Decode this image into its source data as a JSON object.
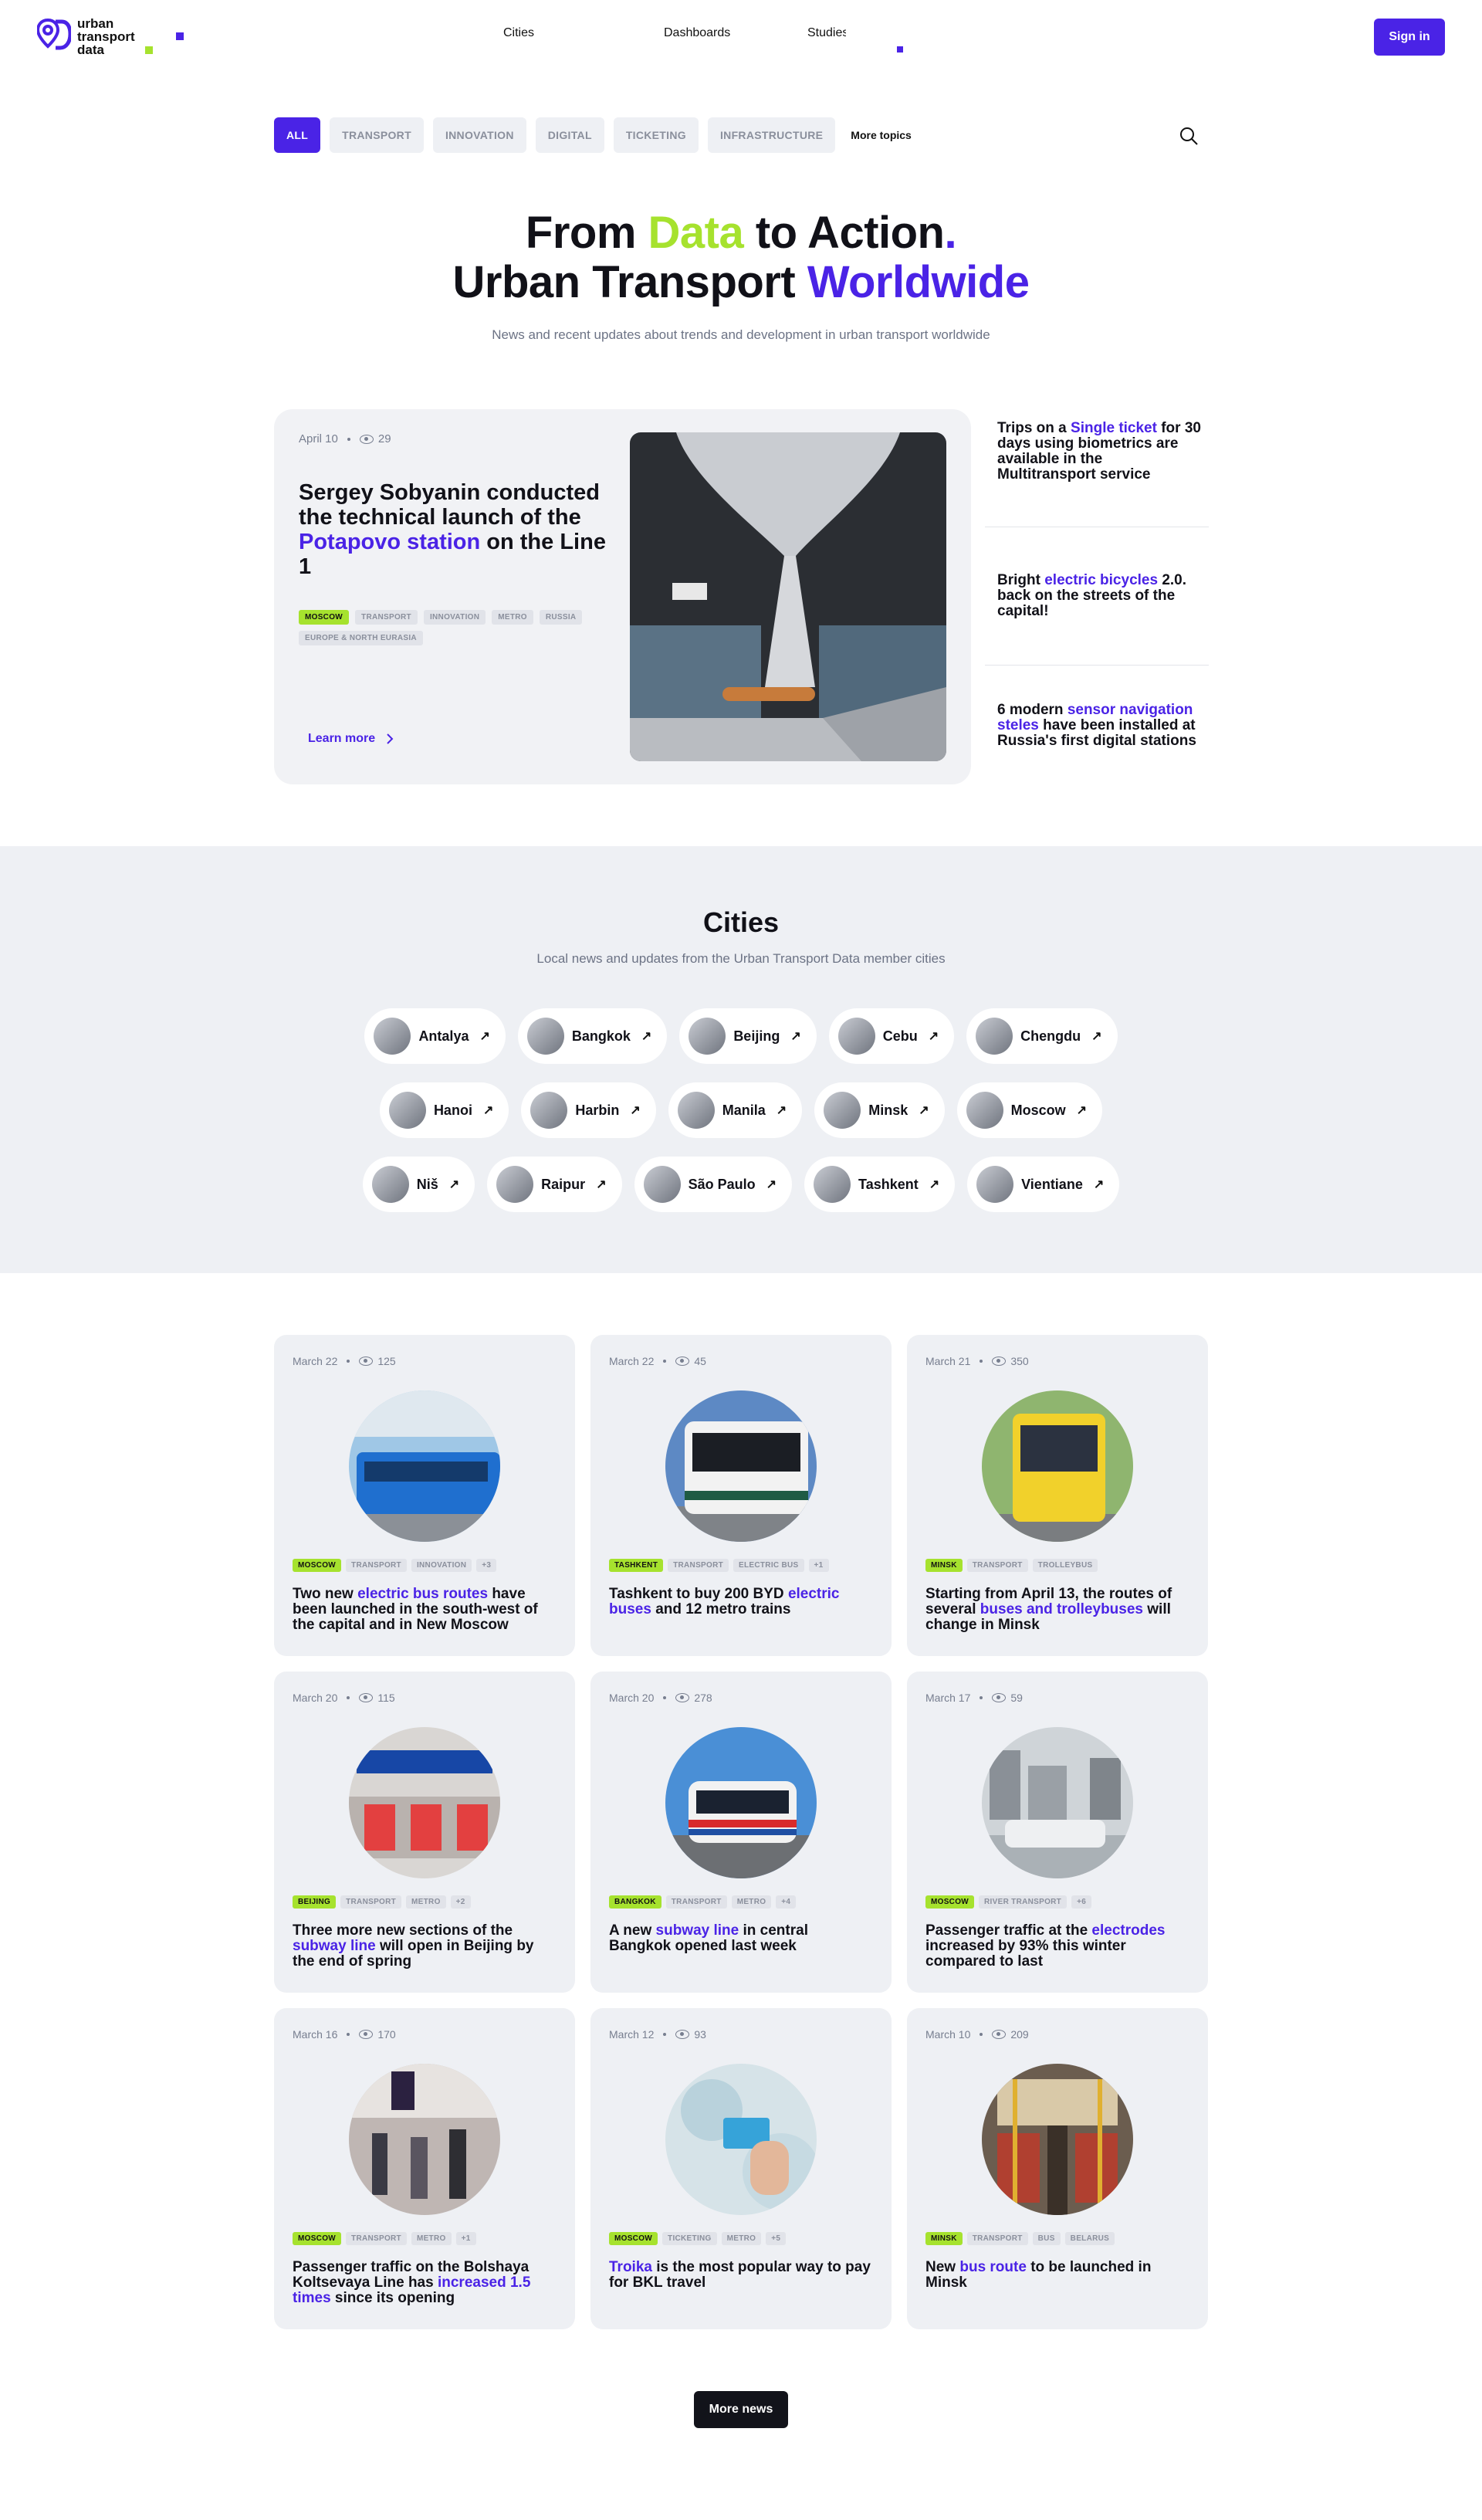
{
  "logo": {
    "line1": "urban",
    "line2": "transport",
    "line3": "data"
  },
  "nav": {
    "items": [
      "Cities",
      "Dashboards",
      "Studies"
    ],
    "signin": "Sign in"
  },
  "topics": {
    "items": [
      "ALL",
      "TRANSPORT",
      "INNOVATION",
      "DIGITAL",
      "TICKETING",
      "INFRASTRUCTURE"
    ],
    "more": "More topics"
  },
  "hero": {
    "l1a": "From ",
    "l1b": "Data",
    "l1c": " to Action",
    "l1d": ".",
    "l2a": "Urban Transport ",
    "l2b": "Worldwide",
    "subtitle": "News and recent updates about trends and development in urban transport worldwide"
  },
  "featured": {
    "date": "April 10",
    "views": "29",
    "t1": "Sergey Sobyanin conducted the technical launch of the ",
    "t2": "Potapovo station",
    "t3": " on the Line 1",
    "tags": [
      "MOSCOW",
      "TRANSPORT",
      "INNOVATION",
      "METRO",
      "RUSSIA",
      "EUROPE & NORTH EURASIA"
    ],
    "learn": "Learn more"
  },
  "side": [
    {
      "a": "Trips on a ",
      "b": "Single ticket",
      "c": " for 30 days using biometrics are available in the Multitransport service"
    },
    {
      "a": "Bright ",
      "b": "electric bicycles",
      "c": " 2.0. back on the streets of the capital!"
    },
    {
      "a": "6 modern ",
      "b": "sensor navigation steles",
      "c": " have been installed at Russia's first digital stations"
    }
  ],
  "cities": {
    "title": "Cities",
    "subtitle": "Local news and updates from the Urban Transport Data member cities",
    "row1": [
      "Antalya",
      "Bangkok",
      "Beijing",
      "Cebu",
      "Chengdu"
    ],
    "row2": [
      "Hanoi",
      "Harbin",
      "Manila",
      "Minsk",
      "Moscow"
    ],
    "row3": [
      "Niš",
      "Raipur",
      "São Paulo",
      "Tashkent",
      "Vientiane"
    ]
  },
  "news": [
    {
      "date": "March 22",
      "views": "125",
      "tags": [
        "MOSCOW",
        "TRANSPORT",
        "INNOVATION",
        "+3"
      ],
      "a": "Two new ",
      "b": "electric bus routes",
      "c": " have been launched in the south-west of the capital and in New Moscow"
    },
    {
      "date": "March 22",
      "views": "45",
      "tags": [
        "TASHKENT",
        "TRANSPORT",
        "ELECTRIC BUS",
        "+1"
      ],
      "a": "Tashkent to buy 200 BYD ",
      "b": "electric buses",
      "c": " and 12 metro trains"
    },
    {
      "date": "March 21",
      "views": "350",
      "tags": [
        "MINSK",
        "TRANSPORT",
        "TROLLEYBUS"
      ],
      "a": "Starting from April 13, the routes of several ",
      "b": "buses and trolleybuses",
      "c": " will change in Minsk"
    },
    {
      "date": "March 20",
      "views": "115",
      "tags": [
        "BEIJING",
        "TRANSPORT",
        "METRO",
        "+2"
      ],
      "a": "Three more new sections of the ",
      "b": "subway line",
      "c": " will open in Beijing by the end of spring"
    },
    {
      "date": "March 20",
      "views": "278",
      "tags": [
        "BANGKOK",
        "TRANSPORT",
        "METRO",
        "+4"
      ],
      "a": "A new ",
      "b": "subway line",
      "c": " in central Bangkok opened last week"
    },
    {
      "date": "March 17",
      "views": "59",
      "tags": [
        "MOSCOW",
        "RIVER TRANSPORT",
        "+6"
      ],
      "a": "Passenger traffic at the ",
      "b": "electrodes",
      "c": " increased by 93% this winter compared to last"
    },
    {
      "date": "March 16",
      "views": "170",
      "tags": [
        "MOSCOW",
        "TRANSPORT",
        "METRO",
        "+1"
      ],
      "a": "Passenger traffic on the Bolshaya Koltsevaya Line has ",
      "b": "increased 1.5 times",
      "c": " since its opening"
    },
    {
      "date": "March 12",
      "views": "93",
      "tags": [
        "MOSCOW",
        "TICKETING",
        "METRO",
        "+5"
      ],
      "a": "",
      "b": "Troika",
      "c": " is the most popular way to pay for BKL travel"
    },
    {
      "date": "March 10",
      "views": "209",
      "tags": [
        "MINSK",
        "TRANSPORT",
        "BUS",
        "BELARUS"
      ],
      "a": "New ",
      "b": "bus route",
      "c": " to be launched in Minsk"
    }
  ],
  "more_news": "More news"
}
